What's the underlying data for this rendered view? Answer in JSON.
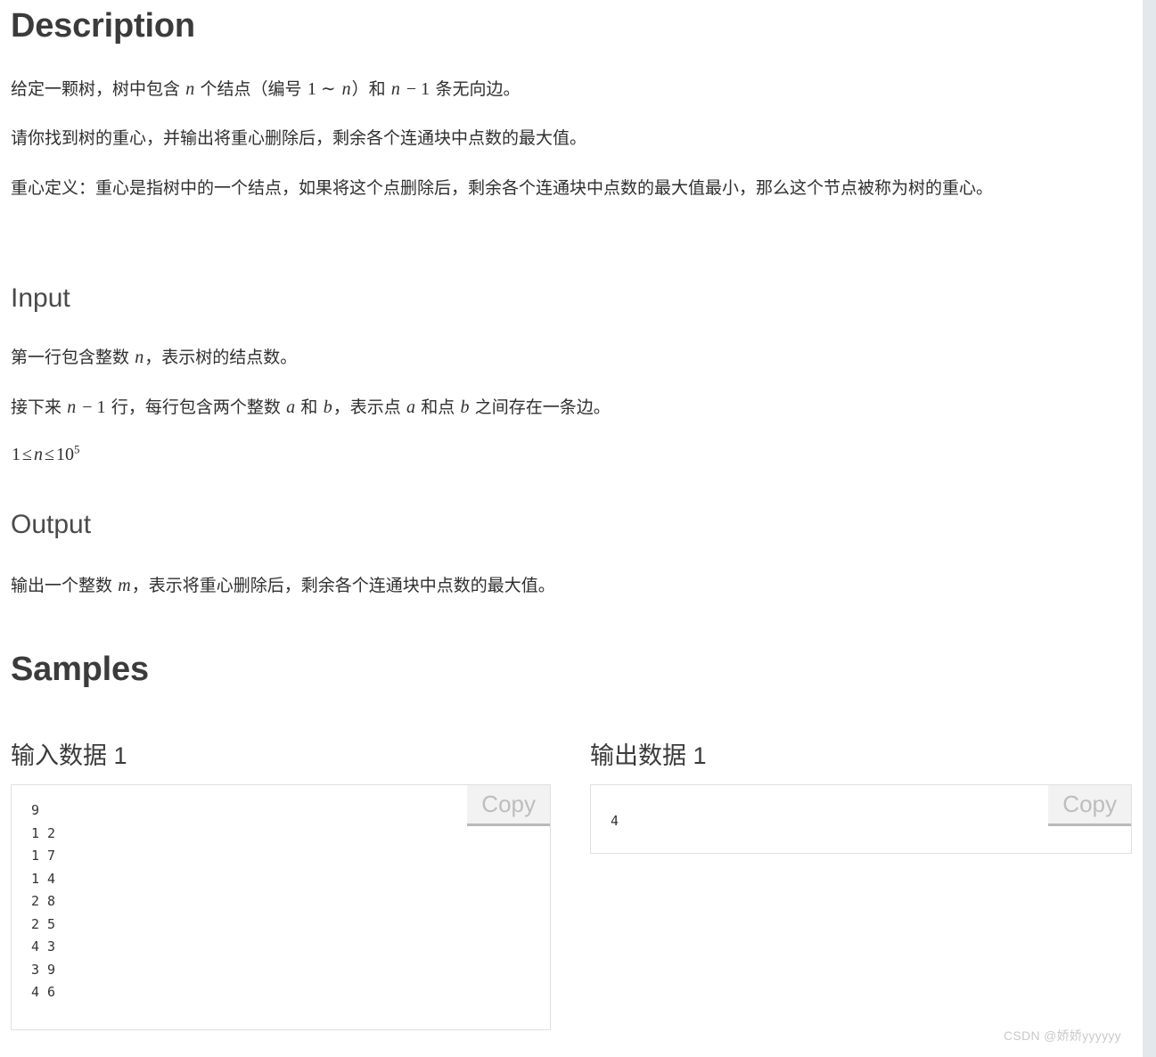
{
  "sections": {
    "description": {
      "title": "Description",
      "paragraphs": [
        {
          "parts": [
            {
              "t": "text",
              "v": "给定一颗树，树中包含 "
            },
            {
              "t": "math",
              "v": "n"
            },
            {
              "t": "text",
              "v": " 个结点（编号 "
            },
            {
              "t": "mathroman",
              "v": "1 ∼ "
            },
            {
              "t": "math",
              "v": "n"
            },
            {
              "t": "text",
              "v": "）和 "
            },
            {
              "t": "math",
              "v": "n"
            },
            {
              "t": "mathroman",
              "v": " − 1"
            },
            {
              "t": "text",
              "v": " 条无向边。"
            }
          ],
          "plain": "给定一颗树，树中包含 n 个结点（编号 1 ∼ n）和 n − 1 条无向边。"
        },
        {
          "parts": [
            {
              "t": "text",
              "v": "请你找到树的重心，并输出将重心删除后，剩余各个连通块中点数的最大值。"
            }
          ],
          "plain": "请你找到树的重心，并输出将重心删除后，剩余各个连通块中点数的最大值。"
        },
        {
          "parts": [
            {
              "t": "text",
              "v": "重心定义：重心是指树中的一个结点，如果将这个点删除后，剩余各个连通块中点数的最大值最小，那么这个节点被称为树的重心。"
            }
          ],
          "plain": "重心定义：重心是指树中的一个结点，如果将这个点删除后，剩余各个连通块中点数的最大值最小，那么这个节点被称为树的重心。"
        }
      ]
    },
    "input": {
      "title": "Input",
      "paragraphs": [
        {
          "plain": "第一行包含整数 n，表示树的结点数。"
        },
        {
          "plain": "接下来 n − 1 行，每行包含两个整数 a 和 b，表示点 a 和点 b 之间存在一条边。"
        },
        {
          "plain": "1 ≤ n ≤ 10^5"
        }
      ],
      "constraint": {
        "lower": "1",
        "rel1": "≤",
        "var": "n",
        "rel2": "≤",
        "base": "10",
        "exponent": "5"
      }
    },
    "output": {
      "title": "Output",
      "paragraphs": [
        {
          "plain": "输出一个整数 m，表示将重心删除后，剩余各个连通块中点数的最大值。"
        }
      ]
    },
    "samples": {
      "title": "Samples",
      "items": [
        {
          "heading": "输入数据 1",
          "copy_label": "Copy",
          "content": "9\n1 2\n1 7\n1 4\n2 8\n2 5\n4 3\n3 9\n4 6"
        },
        {
          "heading": "输出数据 1",
          "copy_label": "Copy",
          "content": "4"
        }
      ]
    }
  },
  "watermark": "CSDN @娇娇yyyyyy",
  "colors": {
    "heading": "#3b3b3b",
    "body_text": "#2f2f2f",
    "box_border": "#e0e0e0",
    "copy_bg": "#f2f2f2",
    "copy_text": "#bdbdbd",
    "right_gutter": "#e3e8ec",
    "watermark": "#c9c9c9"
  }
}
